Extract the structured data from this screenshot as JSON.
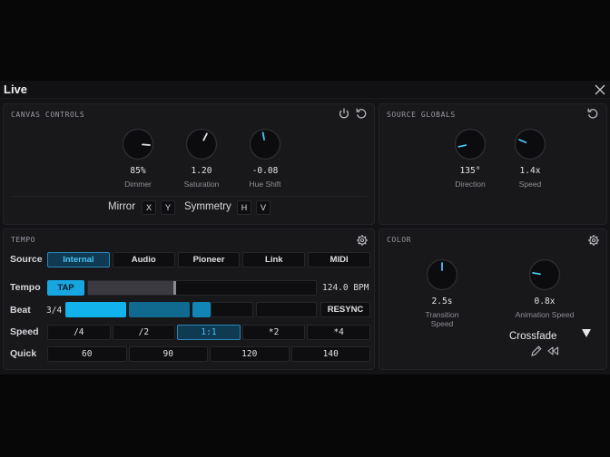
{
  "window": {
    "title": "Live"
  },
  "canvas_controls": {
    "title": "CANVAS CONTROLS",
    "knobs": [
      {
        "value": "85%",
        "label": "Dimmer",
        "level": 0.85
      },
      {
        "value": "1.20",
        "label": "Saturation",
        "level": 0.6
      },
      {
        "value": "-0.08",
        "label": "Hue Shift",
        "level": 0.46
      }
    ],
    "mirror_label": "Mirror",
    "mirror_x": "X",
    "mirror_y": "Y",
    "symmetry_label": "Symmetry",
    "symmetry_h": "H",
    "symmetry_v": "V"
  },
  "source_globals": {
    "title": "SOURCE GLOBALS",
    "knobs": [
      {
        "value": "135°",
        "label": "Direction",
        "level": 0.12
      },
      {
        "value": "1.4x",
        "label": "Speed",
        "level": 0.25
      }
    ]
  },
  "tempo": {
    "title": "TEMPO",
    "source_label": "Source",
    "sources": [
      "Internal",
      "Audio",
      "Pioneer",
      "Link",
      "MIDI"
    ],
    "active_source": 0,
    "tempo_label": "Tempo",
    "tap_label": "TAP",
    "bpm": "124.0 BPM",
    "beat_label": "Beat",
    "beat_value": "3/4",
    "resync_label": "RESYNC",
    "speed_label": "Speed",
    "speeds": [
      "/4",
      "/2",
      "1:1",
      "*2",
      "*4"
    ],
    "active_speed": 2,
    "quick_label": "Quick",
    "quick": [
      "60",
      "90",
      "120",
      "140"
    ]
  },
  "color": {
    "title": "COLOR",
    "knobs": [
      {
        "value": "2.5s",
        "label": "Transition Speed",
        "level": 0.5
      },
      {
        "value": "0.8x",
        "label": "Animation Speed",
        "level": 0.2
      }
    ],
    "mode": "Crossfade"
  },
  "colors": {
    "accent": "#4cc3f5",
    "active_bg": "#0f3a52"
  }
}
